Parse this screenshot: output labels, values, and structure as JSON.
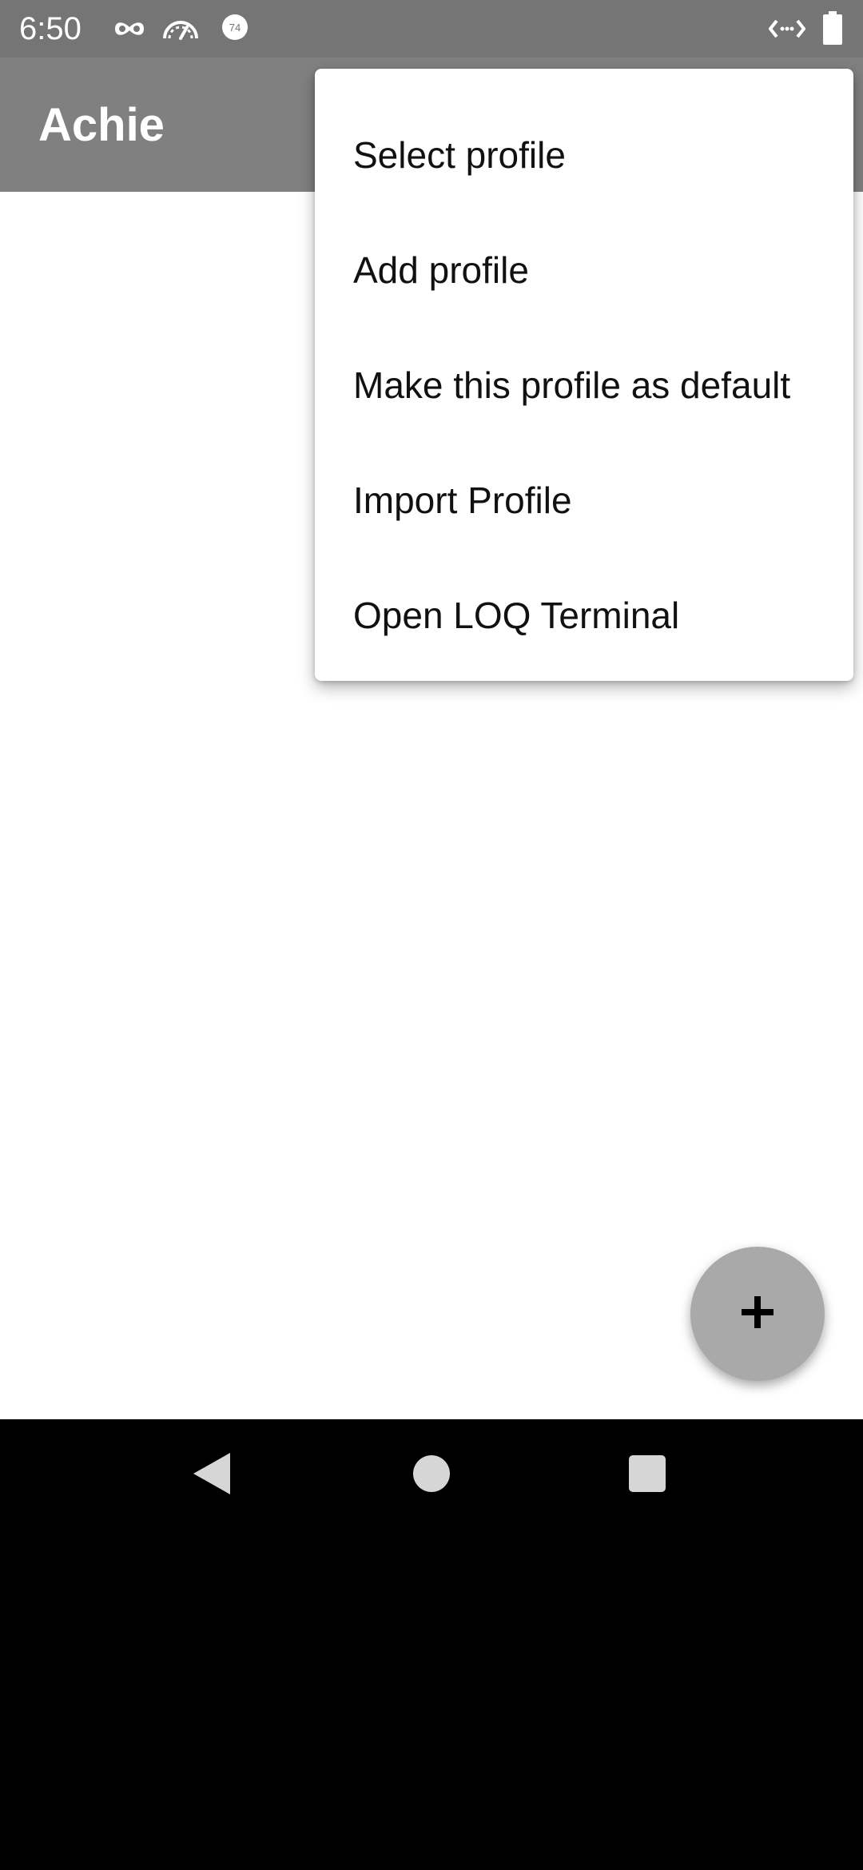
{
  "status_bar": {
    "time": "6:50",
    "icons": [
      "incognito-icon",
      "speedometer-icon",
      "badge-74-icon",
      "code-arrows-icon",
      "battery-icon"
    ],
    "badge_number": "74"
  },
  "app_bar": {
    "title": "Achie",
    "background_color": "#808080"
  },
  "overflow_menu": {
    "items": [
      {
        "label": "Select profile"
      },
      {
        "label": "Add profile"
      },
      {
        "label": "Make this profile as default"
      },
      {
        "label": "Import Profile"
      },
      {
        "label": "Open LOQ Terminal"
      }
    ]
  },
  "fab": {
    "icon": "plus-icon",
    "color": "#a9a9a9"
  },
  "navigation_bar": {
    "buttons": [
      "back-icon",
      "home-icon",
      "recents-icon"
    ]
  }
}
